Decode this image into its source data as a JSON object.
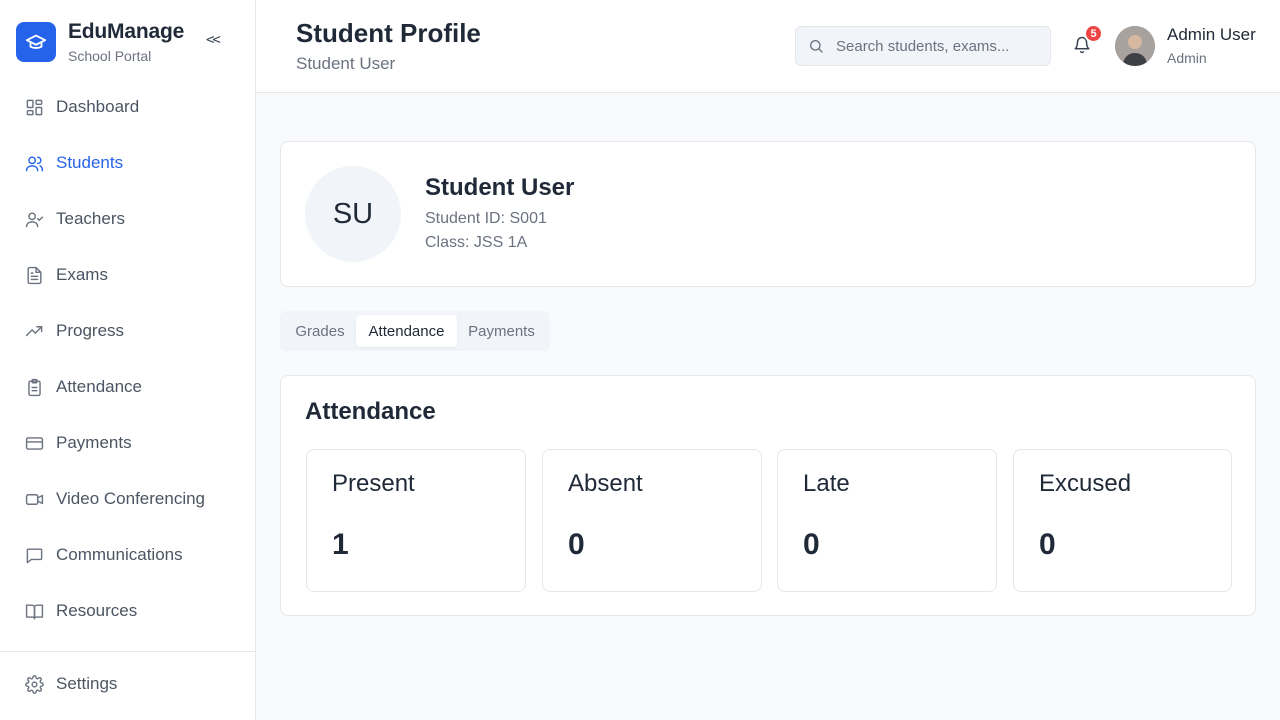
{
  "brand": {
    "name": "EduManage",
    "subtitle": "School Portal",
    "collapse_label": "<<"
  },
  "sidebar": {
    "items": [
      {
        "label": "Dashboard",
        "icon": "dashboard-icon",
        "active": false
      },
      {
        "label": "Students",
        "icon": "users-icon",
        "active": true
      },
      {
        "label": "Teachers",
        "icon": "user-check-icon",
        "active": false
      },
      {
        "label": "Exams",
        "icon": "file-text-icon",
        "active": false
      },
      {
        "label": "Progress",
        "icon": "trending-up-icon",
        "active": false
      },
      {
        "label": "Attendance",
        "icon": "clipboard-icon",
        "active": false
      },
      {
        "label": "Payments",
        "icon": "credit-card-icon",
        "active": false
      },
      {
        "label": "Video Conferencing",
        "icon": "video-icon",
        "active": false
      },
      {
        "label": "Communications",
        "icon": "message-icon",
        "active": false
      },
      {
        "label": "Resources",
        "icon": "book-icon",
        "active": false
      }
    ],
    "settings_label": "Settings"
  },
  "header": {
    "title": "Student Profile",
    "subtitle": "Student User",
    "search_placeholder": "Search students, exams...",
    "notification_count": "5",
    "user_name": "Admin User",
    "user_role": "Admin"
  },
  "profile": {
    "initials": "SU",
    "name": "Student User",
    "student_id": "Student ID: S001",
    "class": "Class: JSS 1A"
  },
  "tabs": [
    {
      "label": "Grades",
      "active": false
    },
    {
      "label": "Attendance",
      "active": true
    },
    {
      "label": "Payments",
      "active": false
    }
  ],
  "attendance": {
    "title": "Attendance",
    "stats": [
      {
        "label": "Present",
        "value": "1"
      },
      {
        "label": "Absent",
        "value": "0"
      },
      {
        "label": "Late",
        "value": "0"
      },
      {
        "label": "Excused",
        "value": "0"
      }
    ]
  },
  "colors": {
    "accent": "#2563eb",
    "badge": "#ef4444",
    "border": "#e5e7eb",
    "background": "#f8fafc"
  }
}
